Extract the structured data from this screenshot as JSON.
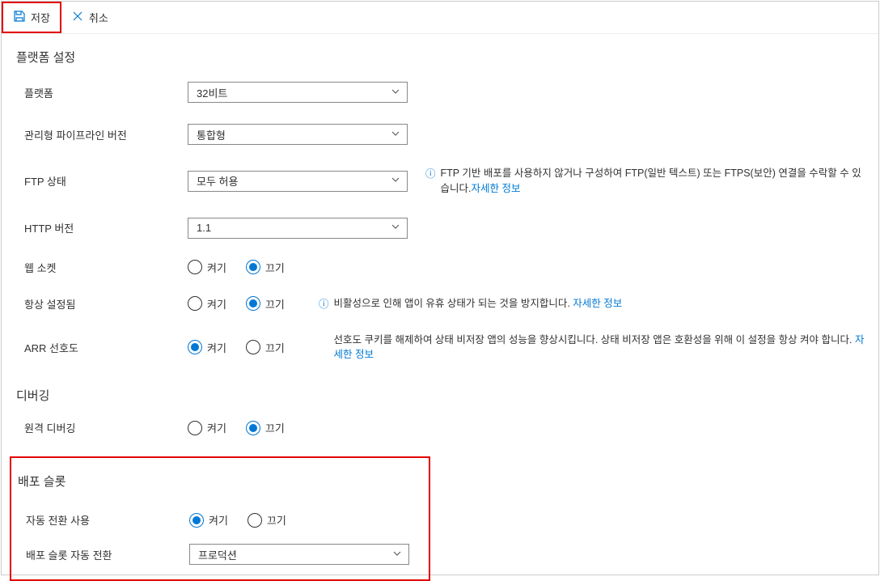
{
  "toolbar": {
    "save_label": "저장",
    "cancel_label": "취소"
  },
  "common": {
    "on_label": "켜기",
    "off_label": "끄기",
    "more_info_label": "자세한 정보"
  },
  "platform": {
    "title": "플랫폼 설정",
    "platform_label": "플랫폼",
    "platform_value": "32비트",
    "pipeline_label": "관리형 파이프라인 버전",
    "pipeline_value": "통합형",
    "ftp_label": "FTP 상태",
    "ftp_value": "모두 허용",
    "ftp_desc": "FTP 기반 배포를 사용하지 않거나 구성하여 FTP(일반 텍스트) 또는 FTPS(보안) 연결을 수락할 수 있습니다.",
    "http_label": "HTTP 버전",
    "http_value": "1.1",
    "websocket_label": "웹 소켓",
    "websocket_value": "off",
    "alwayson_label": "항상 설정됨",
    "alwayson_value": "off",
    "alwayson_desc": "비활성으로 인해 앱이 유휴 상태가 되는 것을 방지합니다. ",
    "arr_label": "ARR 선호도",
    "arr_value": "on",
    "arr_desc": "선호도 쿠키를 해제하여 상태 비저장 앱의 성능을 향상시킵니다. 상태 비저장 앱은 호환성을 위해 이 설정을 항상 켜야 합니다. "
  },
  "debugging": {
    "title": "디버깅",
    "remote_label": "원격 디버깅",
    "remote_value": "off"
  },
  "deployment": {
    "title": "배포 슬롯",
    "autoswap_label": "자동 전환 사용",
    "autoswap_value": "on",
    "slot_label": "배포 슬롯 자동 전환",
    "slot_value": "프로덕션"
  }
}
